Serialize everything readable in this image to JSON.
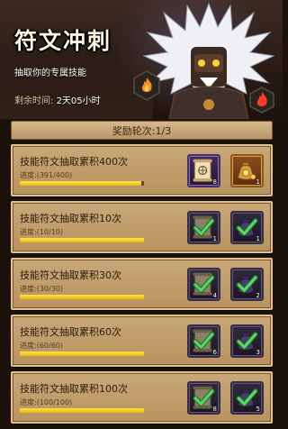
{
  "event": {
    "title": "符文冲刺",
    "subtitle": "抽取你的专属技能",
    "timer_label": "剩余时间:",
    "timer_value": "2天05小时"
  },
  "round": {
    "label": "奖励轮次:1/3"
  },
  "progress_label": "进度:",
  "tasks": [
    {
      "name": "技能符文抽取累积400次",
      "progress_text": "(391/400)",
      "progress": 0.9775,
      "claimed": false,
      "rewards": [
        {
          "icon": "rune-scroll-icon",
          "qty": "8",
          "style": "purple"
        },
        {
          "icon": "coin-bag-icon",
          "qty": "1",
          "style": "gold"
        }
      ]
    },
    {
      "name": "技能符文抽取累积10次",
      "progress_text": "(10/10)",
      "progress": 1.0,
      "claimed": true,
      "rewards": [
        {
          "icon": "rune-scroll-icon",
          "qty": "1",
          "style": "dark"
        },
        {
          "icon": "potion-bag-icon",
          "qty": "1",
          "style": "dark"
        }
      ]
    },
    {
      "name": "技能符文抽取累积30次",
      "progress_text": "(30/30)",
      "progress": 1.0,
      "claimed": true,
      "rewards": [
        {
          "icon": "rune-scroll-icon",
          "qty": "4",
          "style": "dark"
        },
        {
          "icon": "potion-bag-icon",
          "qty": "2",
          "style": "dark"
        }
      ]
    },
    {
      "name": "技能符文抽取累积60次",
      "progress_text": "(60/60)",
      "progress": 1.0,
      "claimed": true,
      "rewards": [
        {
          "icon": "rune-scroll-icon",
          "qty": "6",
          "style": "dark"
        },
        {
          "icon": "potion-bag-icon",
          "qty": "3",
          "style": "dark"
        }
      ]
    },
    {
      "name": "技能符文抽取累积100次",
      "progress_text": "(100/100)",
      "progress": 1.0,
      "claimed": true,
      "rewards": [
        {
          "icon": "rune-scroll-icon",
          "qty": "8",
          "style": "dark"
        },
        {
          "icon": "potion-bag-icon",
          "qty": "5",
          "style": "dark"
        }
      ]
    }
  ],
  "colors": {
    "card": "#c9a777",
    "progress_fill": "#f2c91c",
    "claimed_check": "#4cd35a"
  }
}
